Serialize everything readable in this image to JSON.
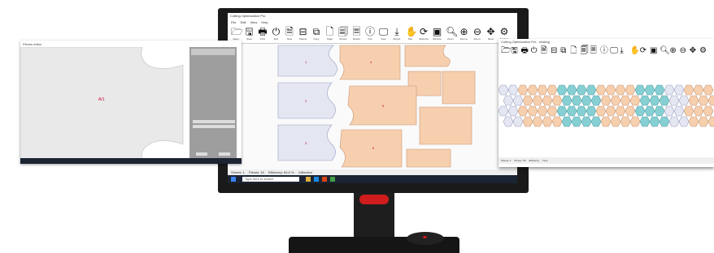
{
  "monitor": {
    "title": "Cutting Optimization Pro",
    "menu": [
      "File",
      "Edit",
      "View",
      "Help"
    ],
    "toolbar": [
      {
        "icon": "folder-open-icon",
        "glyph": "🗁",
        "label": "Open"
      },
      {
        "icon": "save-icon",
        "glyph": "🖫",
        "label": "Save"
      },
      {
        "icon": "print-icon",
        "glyph": "🖶",
        "label": "Print"
      },
      {
        "icon": "power-icon",
        "glyph": "⏻",
        "label": "Exit"
      },
      {
        "icon": "document-icon",
        "glyph": "🗎",
        "label": "New"
      },
      {
        "icon": "sheet-icon",
        "glyph": "⊟",
        "label": "Sheets"
      },
      {
        "icon": "copy-icon",
        "glyph": "⧉",
        "label": "Copy"
      },
      {
        "icon": "page-icon",
        "glyph": "🗋",
        "label": "Page"
      },
      {
        "icon": "pieces-icon",
        "glyph": "🗐",
        "label": "Pieces"
      },
      {
        "icon": "report-icon",
        "glyph": "🗏",
        "label": "Report"
      },
      {
        "icon": "info-icon",
        "glyph": "ⓘ",
        "label": "Info"
      },
      {
        "icon": "monitor-icon",
        "glyph": "🖵",
        "label": "View"
      },
      {
        "icon": "download-icon",
        "glyph": "⤓",
        "label": "Export"
      },
      {
        "icon": "hand-icon",
        "glyph": "✋",
        "label": "Pan"
      },
      {
        "icon": "optimize-icon",
        "glyph": "⟳",
        "label": "Optimize"
      },
      {
        "icon": "window-icon",
        "glyph": "▣",
        "label": "Window"
      },
      {
        "icon": "zoom-icon",
        "glyph": "🔍︎",
        "label": "Zoom"
      },
      {
        "icon": "zoom-in-icon",
        "glyph": "⊕",
        "label": "Zoom+"
      },
      {
        "icon": "zoom-out-icon",
        "glyph": "⊖",
        "label": "Zoom-"
      },
      {
        "icon": "move-icon",
        "glyph": "✥",
        "label": "Move"
      },
      {
        "icon": "settings-icon",
        "glyph": "⚙",
        "label": "Settings"
      }
    ],
    "status": [
      "Sheets: 1",
      "Pieces: 18",
      "Efficiency: 84.6 %",
      "Utilization"
    ],
    "search_placeholder": "Type here to search"
  },
  "left_window": {
    "title": "Pieces editor",
    "piece_label": "A/1"
  },
  "right_window": {
    "title": "Cutting Optimization Pro - nesting",
    "status": [
      "Sheets: 1",
      "Pieces: 96",
      "Efficiency",
      "Time"
    ]
  },
  "colors": {
    "blue_piece": "#e4e6f2",
    "orange_piece": "#f6cfae",
    "teal_piece": "#86d0d4",
    "accent": "#d01c1c"
  }
}
